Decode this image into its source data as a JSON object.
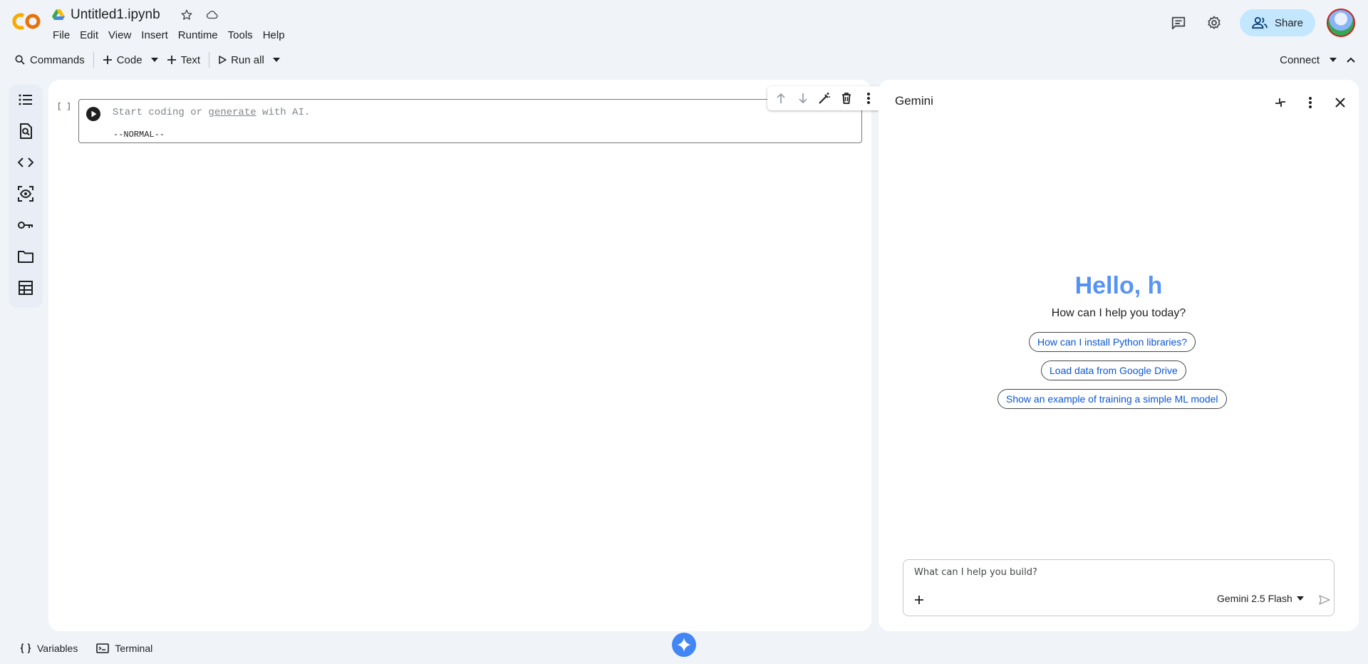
{
  "header": {
    "doc_title": "Untitled1.ipynb",
    "menu": [
      "File",
      "Edit",
      "View",
      "Insert",
      "Runtime",
      "Tools",
      "Help"
    ],
    "share_label": "Share",
    "icons": [
      "colab-logo",
      "drive-icon",
      "star-icon",
      "cloud-icon",
      "comments-icon",
      "settings-icon",
      "share-people-icon",
      "avatar"
    ]
  },
  "toolbar": {
    "commands_label": "Commands",
    "code_label": "Code",
    "text_label": "Text",
    "run_all_label": "Run all",
    "connect_label": "Connect"
  },
  "sidebar": {
    "items": [
      "table-of-contents-icon",
      "find-icon",
      "code-snippets-icon",
      "inspect-icon",
      "secrets-key-icon",
      "files-folder-icon",
      "data-table-icon"
    ]
  },
  "notebook": {
    "exec_count": "[ ]",
    "placeholder_pre": "Start coding or ",
    "placeholder_link": "generate",
    "placeholder_post": " with AI.",
    "mode": "--NORMAL--"
  },
  "gemini": {
    "title": "Gemini",
    "greeting": "Hello, h",
    "subtitle": "How can I help you today?",
    "suggestions": [
      "How can I install Python libraries?",
      "Load data from Google Drive",
      "Show an example of training a simple ML model"
    ],
    "input_placeholder": "What can I help you build?",
    "model": "Gemini 2.5 Flash"
  },
  "bottom": {
    "variables_label": "Variables",
    "terminal_label": "Terminal"
  },
  "colors": {
    "background": "#f0f4f9",
    "share_bg": "#c2e7ff",
    "link_blue": "#0b57d0",
    "gemini_blue": "#4285f4",
    "logo_orange": "#f9ab00"
  }
}
